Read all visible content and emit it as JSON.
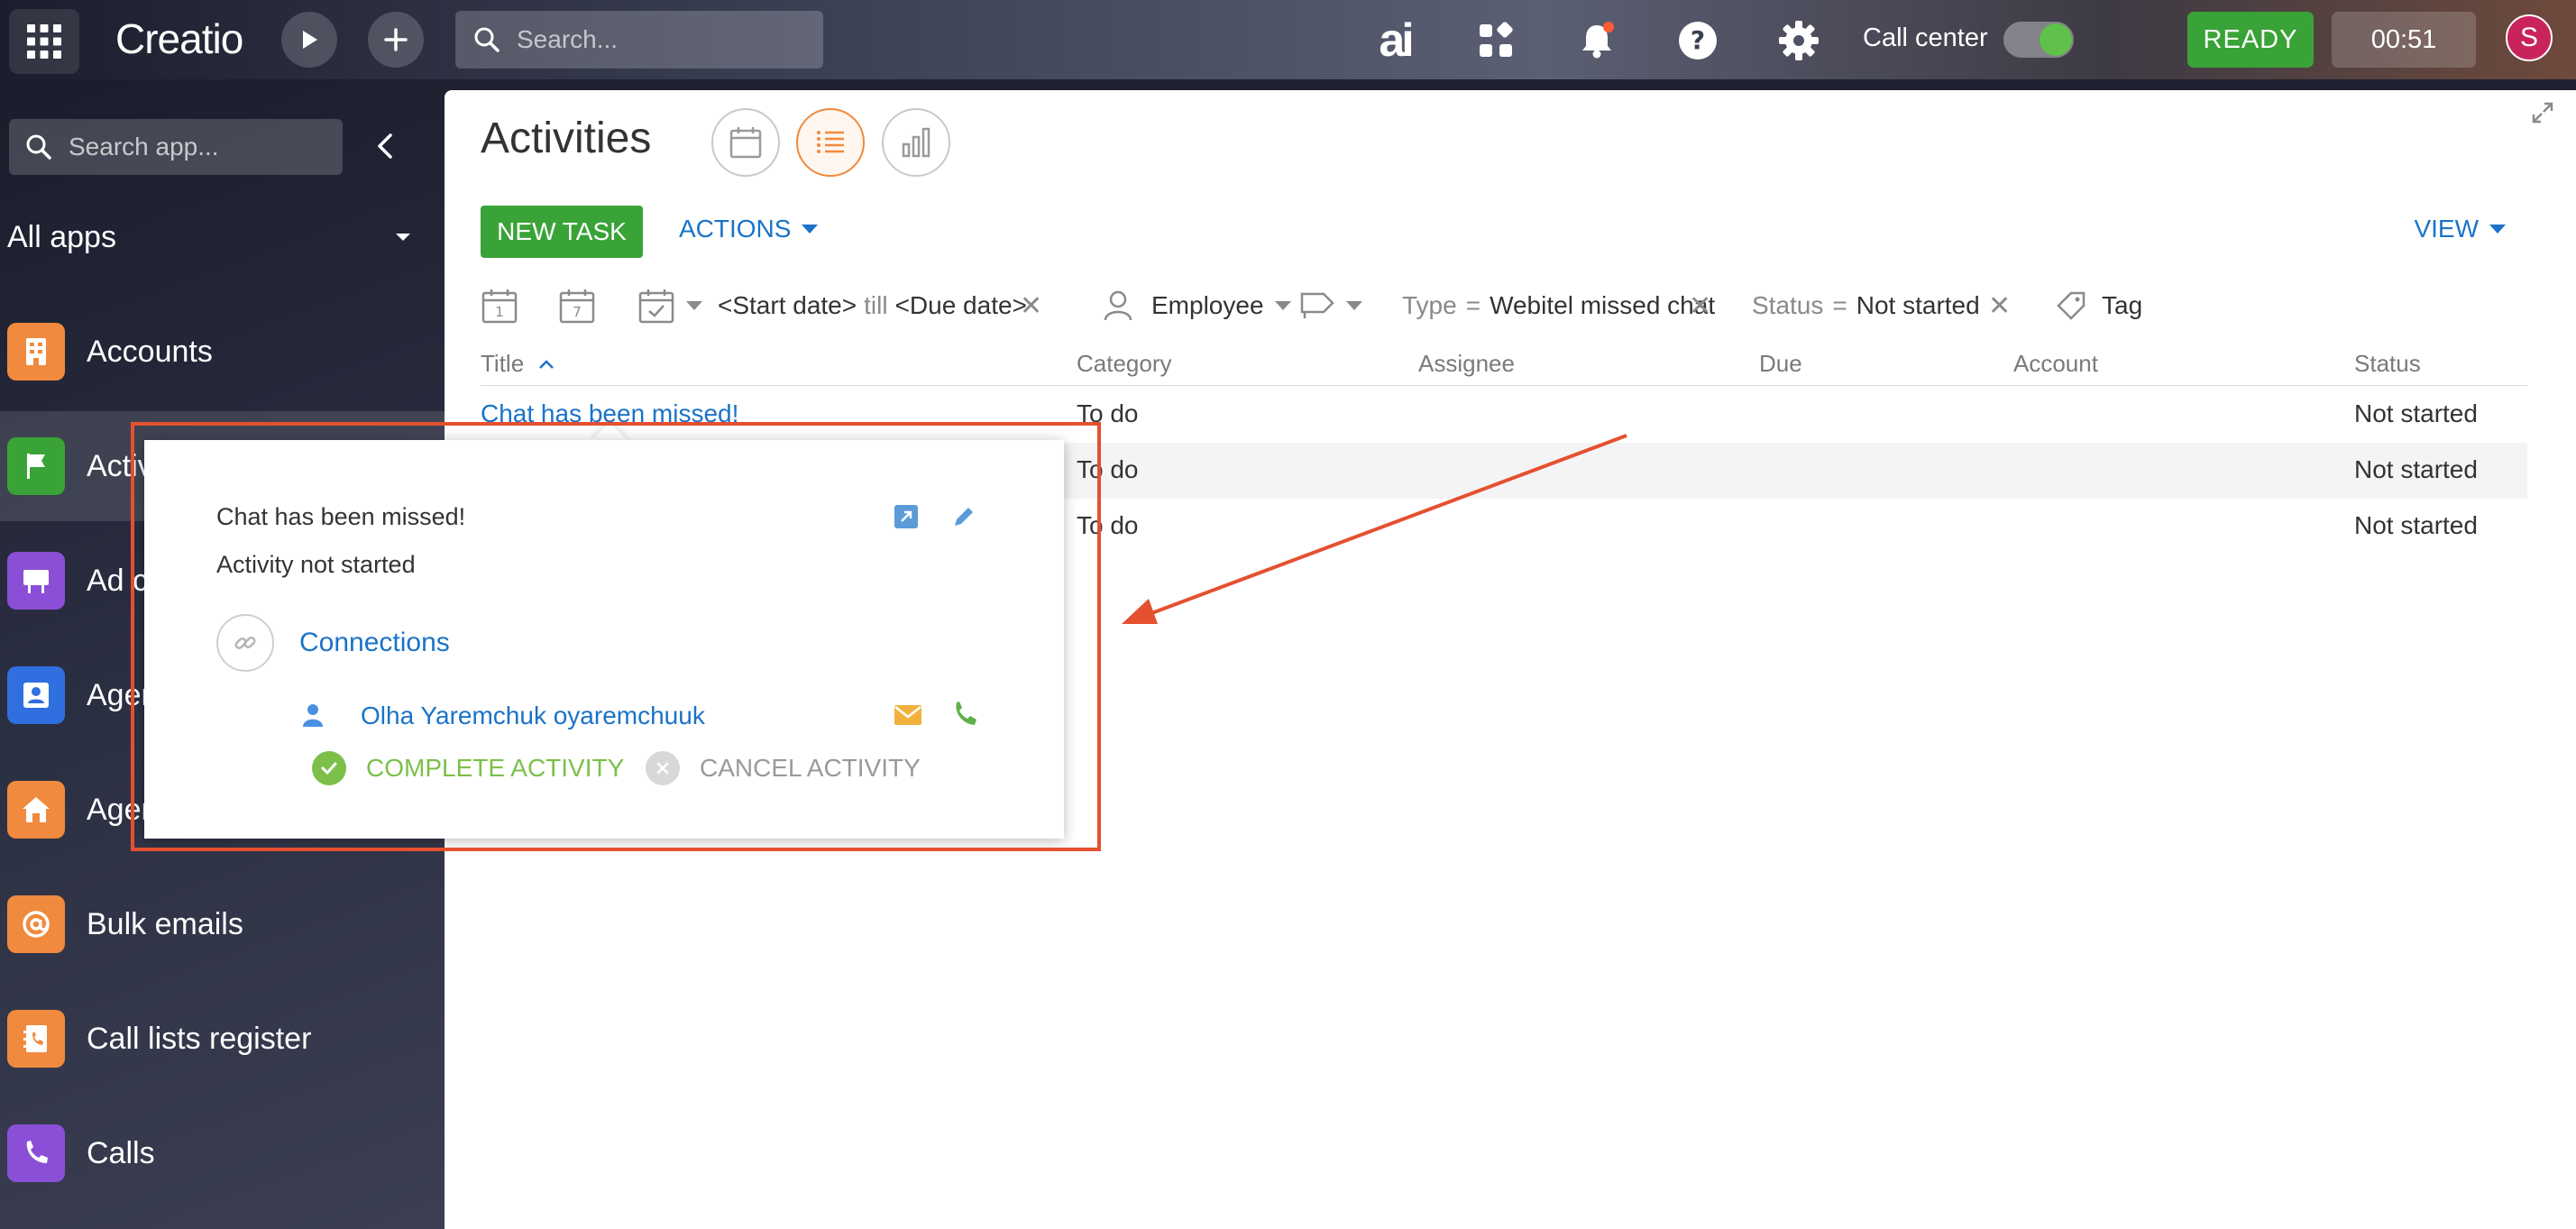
{
  "topbar": {
    "logo_text": "Creatio",
    "search_placeholder": "Search...",
    "ai_label": "ai",
    "call_center_label": "Call center",
    "call_center_on": true,
    "ready_label": "READY",
    "timer": "00:51",
    "avatar_initial": "S",
    "notification_dot_color": "#ff5a36"
  },
  "sidebar": {
    "search_placeholder": "Search app...",
    "all_apps_label": "All apps",
    "items": [
      {
        "label": "Accounts",
        "icon": "building-icon",
        "color": "#f08a3e",
        "active": false
      },
      {
        "label": "Activities",
        "icon": "flag-icon",
        "color": "#3aa337",
        "active": true
      },
      {
        "label": "Ad campaigns",
        "icon": "billboard-icon",
        "color": "#8a4fd6",
        "active": false
      },
      {
        "label": "Agents",
        "icon": "agent-icon",
        "color": "#2f6fe0",
        "active": false
      },
      {
        "label": "Agencies",
        "icon": "home-icon",
        "color": "#f08a3e",
        "active": false
      },
      {
        "label": "Bulk emails",
        "icon": "at-icon",
        "color": "#f08a3e",
        "active": false
      },
      {
        "label": "Call lists register",
        "icon": "contact-book-icon",
        "color": "#f08a3e",
        "active": false
      },
      {
        "label": "Calls",
        "icon": "phone-icon",
        "color": "#8a4fd6",
        "active": false
      }
    ]
  },
  "main": {
    "title": "Activities",
    "new_task_label": "NEW TASK",
    "actions_label": "ACTIONS",
    "view_label": "VIEW",
    "filters": {
      "start_date": "<Start date>",
      "till": "till",
      "due_date": "<Due date>",
      "employee": "Employee",
      "type_label": "Type",
      "equals": "=",
      "type_value": "Webitel missed chat",
      "status_label": "Status",
      "status_value": "Not started",
      "tag_label": "Tag",
      "cal_day": "1",
      "cal_week": "7"
    },
    "columns": [
      "Title",
      "Category",
      "Assignee",
      "Due",
      "Account",
      "Status"
    ],
    "rows": [
      {
        "title": "Chat has been missed!",
        "category": "To do",
        "assignee": "",
        "due": "",
        "account": "",
        "status": "Not started"
      },
      {
        "title": "",
        "category": "To do",
        "assignee": "",
        "due": "",
        "account": "",
        "status": "Not started"
      },
      {
        "title": "",
        "category": "To do",
        "assignee": "",
        "due": "",
        "account": "",
        "status": "Not started"
      }
    ]
  },
  "popup": {
    "title": "Chat has been missed!",
    "status_text": "Activity not started",
    "connections_label": "Connections",
    "contact_name": "Olha Yaremchuk oyaremchuuk",
    "complete_label": "COMPLETE ACTIVITY",
    "cancel_label": "CANCEL ACTIVITY"
  },
  "colors": {
    "accent_blue": "#1a73c9",
    "green": "#3aa337",
    "annotation_red": "#e5502f"
  }
}
